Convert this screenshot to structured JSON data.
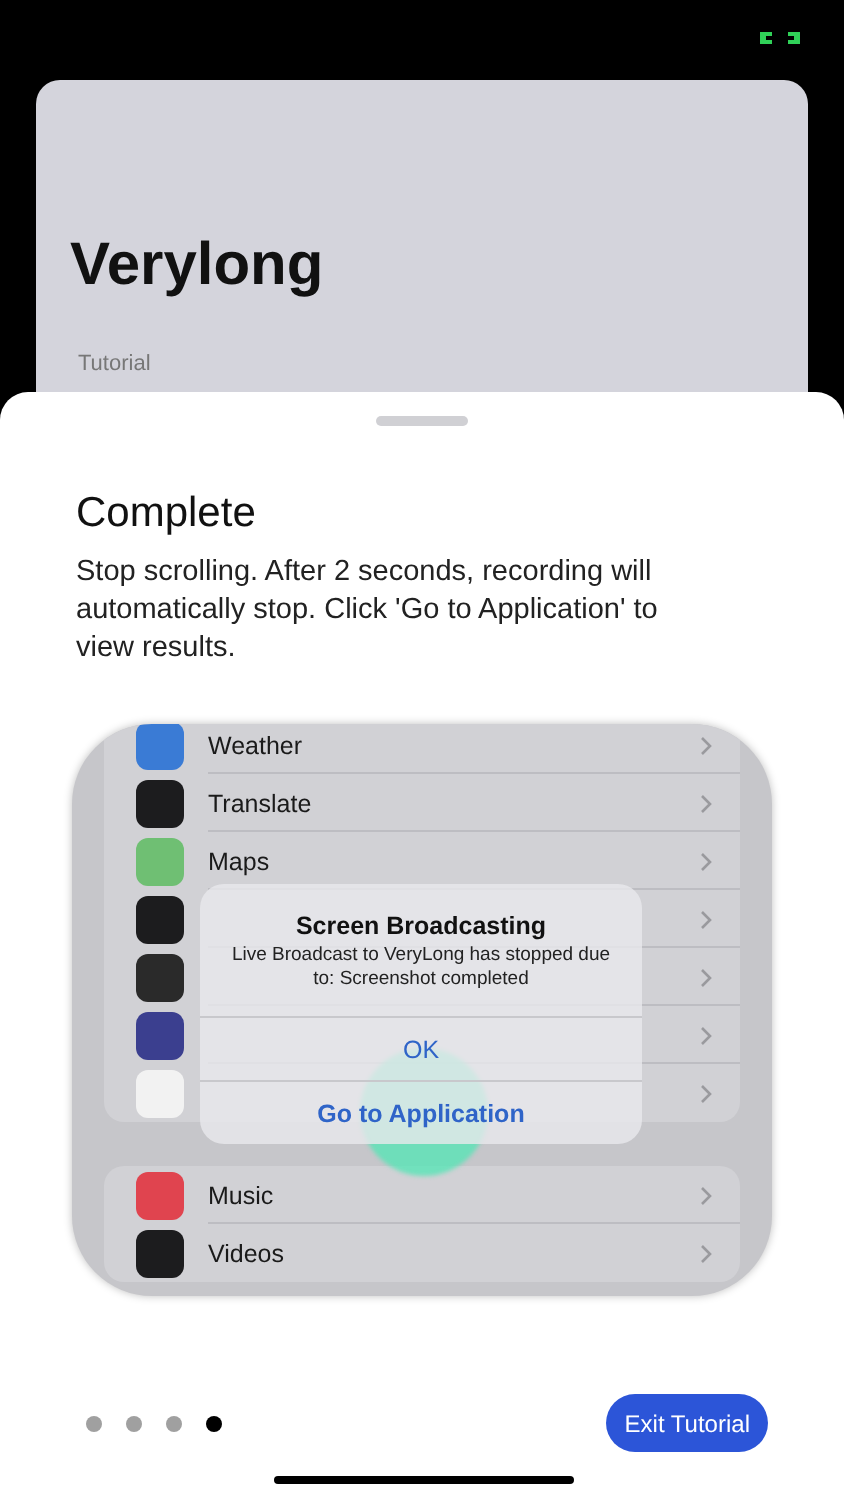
{
  "background_card": {
    "title": "Verylong",
    "subtitle": "Tutorial"
  },
  "sheet": {
    "heading": "Complete",
    "body": "Stop scrolling. After 2 seconds, recording will automatically stop. Click 'Go to Application' to view results."
  },
  "preview": {
    "groups": [
      [
        {
          "label": "Weather",
          "color": "#3a7bd5"
        },
        {
          "label": "Translate",
          "color": "#1c1c1e"
        },
        {
          "label": "Maps",
          "color": "#6fbf73"
        },
        {
          "color": "#1c1c1e"
        },
        {
          "color": "#2a2a2a"
        },
        {
          "color": "#3b3f8f"
        },
        {
          "color": "#f2f2f2"
        }
      ],
      [
        {
          "label": "Music",
          "color": "#e0444f"
        },
        {
          "label": "Videos",
          "color": "#1c1c1e"
        }
      ]
    ],
    "alert": {
      "title": "Screen Broadcasting",
      "message": "Live Broadcast to VeryLong has stopped due to: Screenshot completed",
      "buttons": [
        "OK",
        "Go to Application"
      ]
    }
  },
  "pager": [
    {
      "selected": false
    },
    {
      "selected": false
    },
    {
      "selected": false
    },
    {
      "selected": true
    }
  ],
  "exit_button": "Exit Tutorial"
}
